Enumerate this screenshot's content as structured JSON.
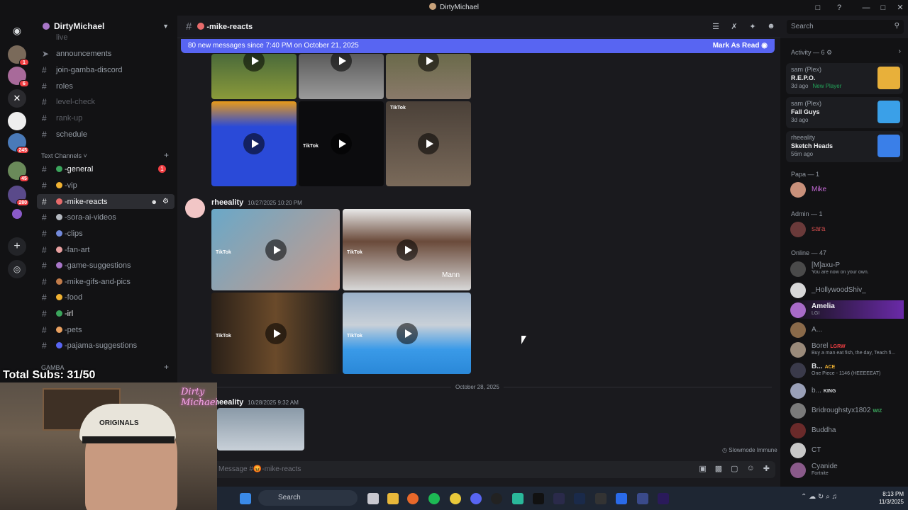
{
  "window": {
    "title": "DirtyMichael"
  },
  "server": {
    "name": "DirtyMichael"
  },
  "server_badges": [
    "1",
    "6",
    "245",
    "45",
    "280"
  ],
  "channels": [
    {
      "name": "live",
      "kind": "text",
      "state": "muted"
    },
    {
      "name": "announcements",
      "kind": "announce",
      "state": "normal"
    },
    {
      "name": "join-gamba-discord",
      "kind": "text",
      "state": "normal"
    },
    {
      "name": "roles",
      "kind": "text",
      "state": "normal"
    },
    {
      "name": "level-check",
      "kind": "text",
      "state": "muted"
    },
    {
      "name": "rank-up",
      "kind": "text",
      "state": "muted"
    },
    {
      "name": "schedule",
      "kind": "text",
      "state": "normal"
    }
  ],
  "text_category": {
    "label": "Text Channels"
  },
  "text_channels": [
    {
      "name": "-general",
      "emoji_color": "#3ba55c",
      "state": "unread",
      "badge": "1"
    },
    {
      "name": "-vip",
      "emoji_color": "#f0b232",
      "state": "normal"
    },
    {
      "name": "-mike-reacts",
      "emoji_color": "#e86b6b",
      "state": "active"
    },
    {
      "name": "-sora-ai-videos",
      "emoji_color": "#b5bac1",
      "state": "normal"
    },
    {
      "name": "-clips",
      "emoji_color": "#7289da",
      "state": "normal"
    },
    {
      "name": "-fan-art",
      "emoji_color": "#e8a0a0",
      "state": "normal"
    },
    {
      "name": "-game-suggestions",
      "emoji_color": "#a876c8",
      "state": "normal"
    },
    {
      "name": "-mike-gifs-and-pics",
      "emoji_color": "#c27c4a",
      "state": "normal"
    },
    {
      "name": "-irl",
      "emoji_color": "#3ba55c",
      "state": "unread"
    },
    {
      "name": "-pets",
      "emoji_color": "#e8a060",
      "state": "normal"
    },
    {
      "name": "-food",
      "emoji_color": "#f0b232",
      "state": "normal"
    },
    {
      "name": "-pajama-suggestions",
      "emoji_color": "#5865f2",
      "state": "normal"
    }
  ],
  "gamba_category": {
    "label": "GAMBA"
  },
  "overlay": {
    "subs": "Total Subs: 31/50",
    "cap_text": "ORIGINALS",
    "neon": "Dirty Michael"
  },
  "chat": {
    "channel_name": "-mike-reacts",
    "new_messages": "80 new messages since 7:40 PM on October 21, 2025",
    "mark_as_read": "Mark As Read",
    "messages": [
      {
        "author": "rheeality",
        "time": "10/27/2025 10:20 PM"
      },
      {
        "author": "rheeality",
        "time": "10/28/2025 9:32 AM"
      }
    ],
    "date_divider": "October 28, 2025",
    "slowmode": "Slowmode Immune",
    "composer_placeholder": "Message #😡-mike-reacts",
    "thumb_labels": {
      "tiktok": "TikTok",
      "watermark": "Mann"
    }
  },
  "search": {
    "placeholder": "Search"
  },
  "activity": {
    "header": "Activity — 6",
    "items": [
      {
        "who": "sam (Plex)",
        "game": "R.E.P.O.",
        "ago": "3d ago",
        "extra": "New Player",
        "art": "#e8b03a"
      },
      {
        "who": "sam (Plex)",
        "game": "Fall Guys",
        "ago": "3d ago",
        "extra": "",
        "art": "#3aa0e8"
      },
      {
        "who": "rheeality",
        "game": "Sketch Heads",
        "ago": "56m ago",
        "extra": "",
        "art": "#3a7fe8"
      }
    ]
  },
  "members": {
    "papa_header": "Papa — 1",
    "papa": [
      {
        "name": "Mike",
        "color": "#c76bd8",
        "status": "",
        "tag": ""
      }
    ],
    "admin_header": "Admin — 1",
    "admin": [
      {
        "name": "sara",
        "color": "#c84a4a",
        "status": "",
        "tag": ""
      }
    ],
    "online_header": "Online — 47",
    "online": [
      {
        "name": "[M]axu-P",
        "status": "You are now on your own.",
        "tag": "",
        "color": "#949ba4"
      },
      {
        "name": "_HollywoodShiv_",
        "status": "",
        "tag": "",
        "color": "#949ba4"
      },
      {
        "name": "Amelia",
        "status": "LGI",
        "tag": "",
        "color": "#f2f3f5"
      },
      {
        "name": "A...",
        "status": "",
        "tag": "",
        "color": "#949ba4"
      },
      {
        "name": "Borel",
        "status": "Buy a man eat fish, the day, Teach fi...",
        "tag": "LGRW",
        "color": "#949ba4"
      },
      {
        "name": "B...",
        "status": "One Piece - 1146 (HEEEEEAT)",
        "tag": "ACE",
        "color": "#dbdee1"
      },
      {
        "name": "b...",
        "status": "",
        "tag": "KING",
        "color": "#949ba4"
      },
      {
        "name": "Bridroughstyx1802",
        "status": "",
        "tag": "WIZ",
        "color": "#949ba4"
      },
      {
        "name": "Buddha",
        "status": "",
        "tag": "",
        "color": "#949ba4"
      },
      {
        "name": "CT",
        "status": "",
        "tag": "",
        "color": "#949ba4"
      },
      {
        "name": "Cyanide",
        "status": "Fortnite",
        "tag": "",
        "color": "#949ba4"
      }
    ]
  },
  "taskbar": {
    "search": "Search",
    "time": "8:13 PM",
    "date": "11/3/2025"
  }
}
